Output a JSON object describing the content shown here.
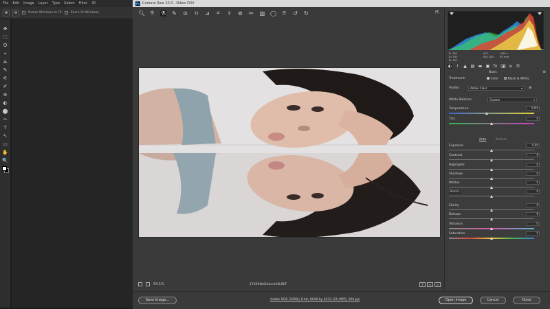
{
  "photoshop": {
    "menus": [
      "File",
      "Edit",
      "Image",
      "Layer",
      "Type",
      "Select",
      "Filter",
      "3D"
    ],
    "options_bar": {
      "resize_windows_label": "Resize Windows to Fit",
      "zoom_all_windows_label": "Zoom All Windows"
    },
    "tools": [
      "✥",
      "⬚",
      "ʘ",
      "⌖",
      "⟁",
      "✎",
      "⚟",
      "✐",
      "⊕",
      "◐",
      "⬤",
      "✑",
      "T",
      "↖",
      "▭",
      "✋",
      "🔍"
    ]
  },
  "camera_raw": {
    "title": "Camera Raw 10.0 - Nikon D3X",
    "ps_logo_text": "Ps",
    "toolbar_icons": [
      "zoom-icon",
      "hand-icon",
      "white-balance-icon",
      "color-sampler-icon",
      "targeted-adjustment-icon",
      "crop-icon",
      "straighten-icon",
      "transform-icon",
      "spot-removal-icon",
      "red-eye-icon",
      "adjustment-brush-icon",
      "graduated-filter-icon",
      "radial-filter-icon",
      "preferences-icon",
      "rotate-ccw-icon",
      "rotate-cw-icon"
    ],
    "statusbar": {
      "zoom_value": "94.1%",
      "filename": "17094WeDeduct10LNEF",
      "view_buttons": [
        "Y",
        "▭",
        "▭"
      ]
    },
    "footer": {
      "save_button": "Save Image...",
      "workflow_link": "Adobe RGB (1998); 8 bit; 6048 by 4032 (24.4MP); 300 ppi",
      "open_button": "Open Image",
      "cancel_button": "Cancel",
      "done_button": "Done"
    },
    "info": {
      "r_label": "R:",
      "g_label": "G:",
      "b_label": "B:",
      "r": "151",
      "g": "151",
      "b": "151",
      "aperture": "f/11",
      "shutter": "1/60 s",
      "iso": "ISO 100",
      "focal": "85 mm"
    },
    "panel": {
      "title": "Basic",
      "treatment_label": "Treatment:",
      "color_option": "Color",
      "bw_option": "Black & White",
      "profile_label": "Profile:",
      "profile_value": "Adobe Color",
      "white_balance_label": "White Balance:",
      "white_balance_value": "Custom",
      "auto_label": "Auto",
      "default_label": "Default",
      "sliders": [
        {
          "name": "temperature",
          "label": "Temperature",
          "value": "5350",
          "position": 0.44
        },
        {
          "name": "tint",
          "label": "Tint",
          "value": "0",
          "position": 0.5
        },
        {
          "name": "exposure",
          "label": "Exposure",
          "value": "0.00",
          "position": 0.5
        },
        {
          "name": "contrast",
          "label": "Contrast",
          "value": "0",
          "position": 0.5
        },
        {
          "name": "highlights",
          "label": "Highlights",
          "value": "0",
          "position": 0.5
        },
        {
          "name": "shadows",
          "label": "Shadows",
          "value": "0",
          "position": 0.5
        },
        {
          "name": "whites",
          "label": "Whites",
          "value": "0",
          "position": 0.5
        },
        {
          "name": "blacks",
          "label": "Blacks",
          "value": "0",
          "position": 0.5
        },
        {
          "name": "clarity",
          "label": "Clarity",
          "value": "0",
          "position": 0.5
        },
        {
          "name": "dehaze",
          "label": "Dehaze",
          "value": "0",
          "position": 0.5
        },
        {
          "name": "vibrance",
          "label": "Vibrance",
          "value": "0",
          "position": 0.5
        },
        {
          "name": "saturation",
          "label": "Saturation",
          "value": "0",
          "position": 0.5
        }
      ]
    }
  }
}
